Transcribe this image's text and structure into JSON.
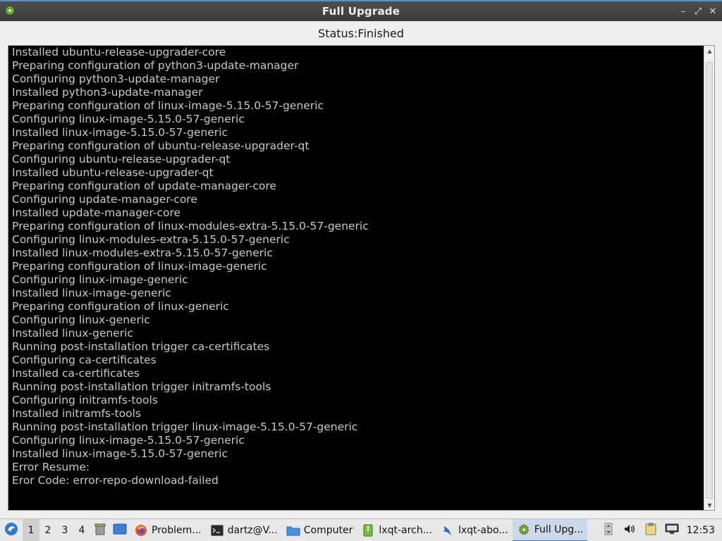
{
  "window": {
    "title": "Full Upgrade",
    "minimize_glyph": "–",
    "restore_glyph": "⤢",
    "close_glyph": "✕"
  },
  "status": {
    "text": "Status:Finished"
  },
  "log": {
    "lines": [
      "Installed ubuntu-release-upgrader-core",
      "Preparing configuration of python3-update-manager",
      "Configuring python3-update-manager",
      "Installed python3-update-manager",
      "Preparing configuration of linux-image-5.15.0-57-generic",
      "Configuring linux-image-5.15.0-57-generic",
      "Installed linux-image-5.15.0-57-generic",
      "Preparing configuration of ubuntu-release-upgrader-qt",
      "Configuring ubuntu-release-upgrader-qt",
      "Installed ubuntu-release-upgrader-qt",
      "Preparing configuration of update-manager-core",
      "Configuring update-manager-core",
      "Installed update-manager-core",
      "Preparing configuration of linux-modules-extra-5.15.0-57-generic",
      "Configuring linux-modules-extra-5.15.0-57-generic",
      "Installed linux-modules-extra-5.15.0-57-generic",
      "Preparing configuration of linux-image-generic",
      "Configuring linux-image-generic",
      "Installed linux-image-generic",
      "Preparing configuration of linux-generic",
      "Configuring linux-generic",
      "Installed linux-generic",
      "Running post-installation trigger ca-certificates",
      "Configuring ca-certificates",
      "Installed ca-certificates",
      "Running post-installation trigger initramfs-tools",
      "Configuring initramfs-tools",
      "Installed initramfs-tools",
      "Running post-installation trigger linux-image-5.15.0-57-generic",
      "Configuring linux-image-5.15.0-57-generic",
      "Installed linux-image-5.15.0-57-generic",
      "Error Resume:",
      "Eror Code: error-repo-download-failed"
    ]
  },
  "taskbar": {
    "desktops": [
      "1",
      "2",
      "3",
      "4"
    ],
    "active_desktop": "1",
    "tasks": [
      {
        "label": "Problem...",
        "icon": "firefox-icon"
      },
      {
        "label": "dartz@V...",
        "icon": "terminal-icon"
      },
      {
        "label": "Computer",
        "icon": "folder-icon"
      },
      {
        "label": "lxqt-arch...",
        "icon": "archive-icon"
      },
      {
        "label": "lxqt-abo...",
        "icon": "lxqt-icon"
      },
      {
        "label": "Full Upg...",
        "icon": "gear-icon",
        "active": true
      }
    ],
    "clock": "12:53"
  },
  "colors": {
    "titlebar_accent": "#5c8fd0",
    "log_background": "#000000",
    "log_text": "#c8c8c8"
  }
}
